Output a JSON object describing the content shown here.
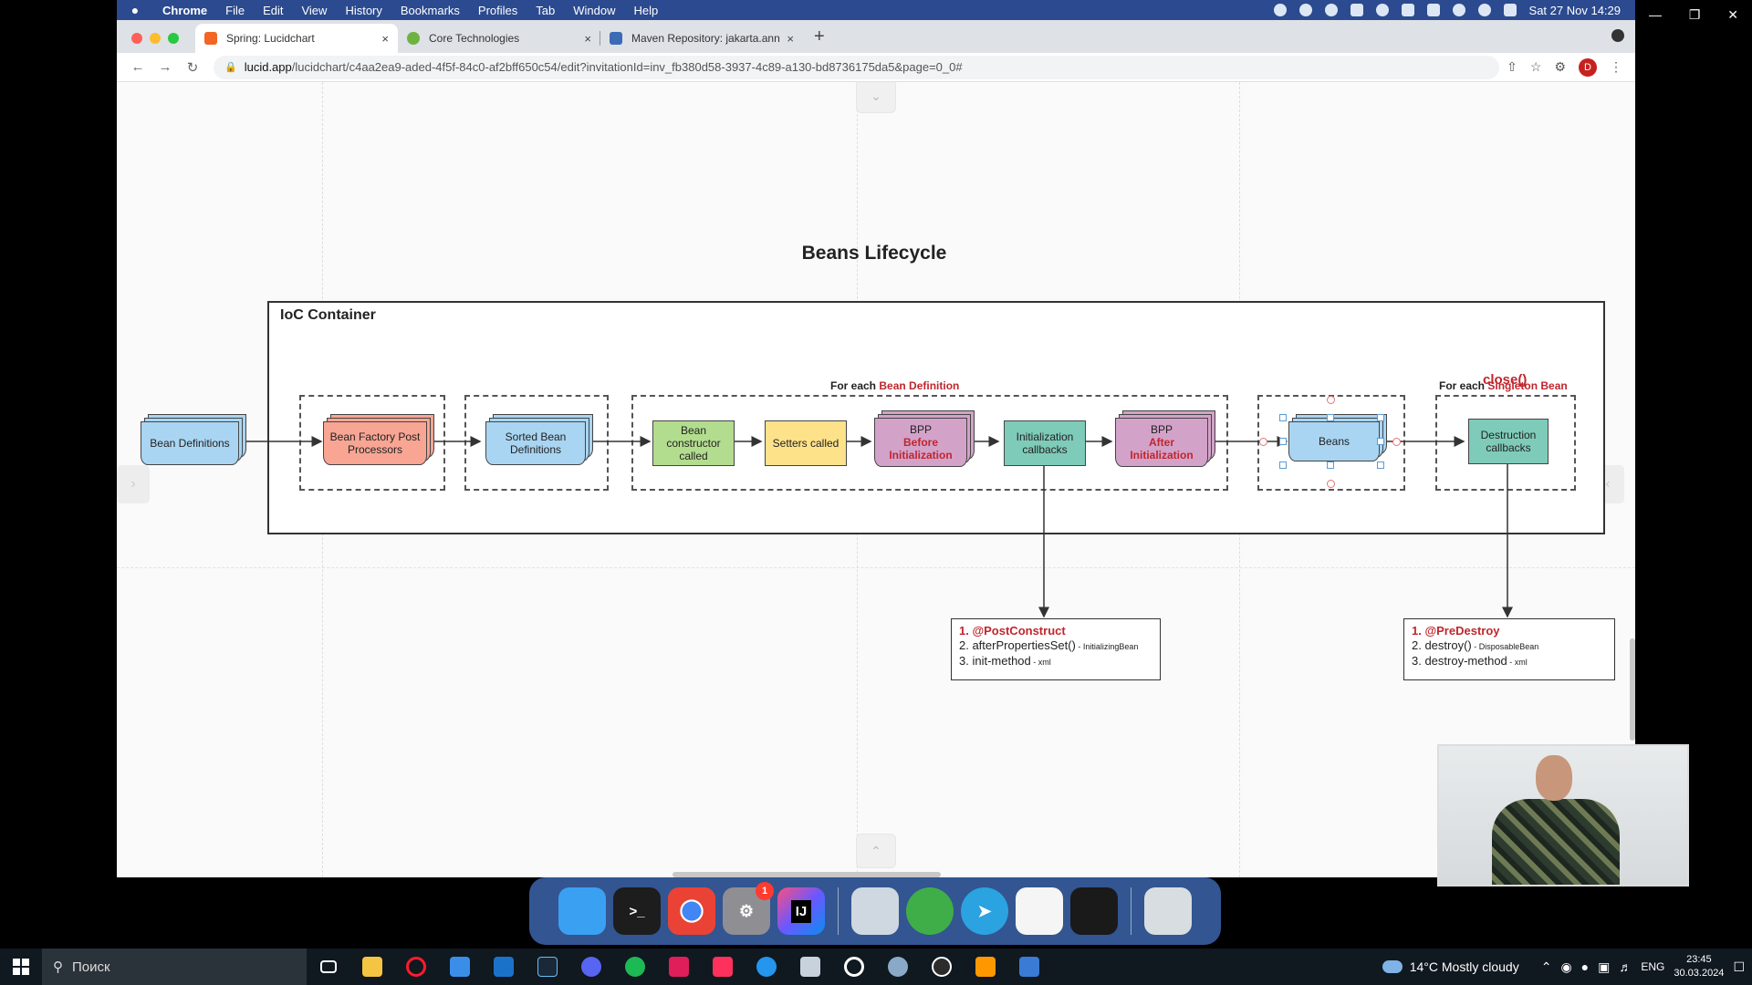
{
  "menubar": {
    "app_name": "Chrome",
    "menus": [
      "File",
      "Edit",
      "View",
      "History",
      "Bookmarks",
      "Profiles",
      "Tab",
      "Window",
      "Help"
    ],
    "datetime": "Sat 27 Nov  14:29"
  },
  "tabs": [
    {
      "title": "Spring: Lucidchart",
      "close": "×",
      "color": "#f26522"
    },
    {
      "title": "Core Technologies",
      "close": "×",
      "color": "#6db33f"
    },
    {
      "title": "Maven Repository: jakarta.ann",
      "close": "×",
      "color": "#3b6bb5"
    }
  ],
  "new_tab": "+",
  "address": {
    "host": "lucid.app",
    "path": "/lucidchart/c4aa2ea9-aded-4f5f-84c0-af2bff650c54/edit?invitationId=inv_fb380d58-3937-4c89-a130-bd8736175da5&page=0_0#"
  },
  "profile_initial": "D",
  "diagram": {
    "title": "Beans Lifecycle",
    "container_label": "IoC Container",
    "caption_each_def": {
      "prefix": "For each ",
      "highlight": "Bean Definition"
    },
    "caption_each_singleton": {
      "prefix": "For each ",
      "highlight": "Singleton Bean"
    },
    "close_label": "close()",
    "nodes": {
      "bean_definitions": "Bean Definitions",
      "bfpp": "Bean Factory Post Processors",
      "sorted_defs": "Sorted Bean Definitions",
      "constructor": "Bean constructor called",
      "setters": "Setters called",
      "bpp_before_top": "BPP",
      "bpp_before_hl": "Before Initialization",
      "init_callbacks": "Initialization callbacks",
      "bpp_after_top": "BPP",
      "bpp_after_hl": "After Initialization",
      "beans": "Beans",
      "destruction": "Destruction callbacks"
    },
    "init_note": {
      "l1": "1. @PostConstruct",
      "l2": "2. afterPropertiesSet()",
      "l2_small": " - InitializingBean",
      "l3": "3. init-method",
      "l3_small": " - xml"
    },
    "destroy_note": {
      "l1": "1. @PreDestroy",
      "l2": "2. destroy()",
      "l2_small": " - DisposableBean",
      "l3": "3. destroy-method",
      "l3_small": " - xml"
    },
    "colors": {
      "blue": "#a9d5f2",
      "salmon": "#f8a594",
      "green": "#b3dd8e",
      "yellow": "#fde28a",
      "purple": "#d3a2c9",
      "teal": "#7ecbb9",
      "accent_red": "#c0262d"
    }
  },
  "dock": {
    "apps": [
      {
        "name": "finder-icon",
        "color": "#3aa0f2",
        "glyph": ""
      },
      {
        "name": "terminal-icon",
        "color": "#1d1d1d",
        "glyph": ">_"
      },
      {
        "name": "chrome-icon",
        "color": "#e6e6e6",
        "glyph": ""
      },
      {
        "name": "system-preferences-icon",
        "color": "#8e8e93",
        "glyph": "⚙",
        "badge": "1"
      },
      {
        "name": "intellij-icon",
        "color": "#000000",
        "glyph": "IJ"
      },
      {
        "name": "preview-icon",
        "color": "#cfd8e0",
        "glyph": ""
      },
      {
        "name": "network-icon",
        "color": "#3fae49",
        "glyph": ""
      },
      {
        "name": "telegram-icon",
        "color": "#2aa3e0",
        "glyph": "➤"
      },
      {
        "name": "textedit-icon",
        "color": "#f5f5f5",
        "glyph": ""
      },
      {
        "name": "audio-app-icon",
        "color": "#1a1a1a",
        "glyph": ""
      },
      {
        "name": "trash-icon",
        "color": "#d8dde2",
        "glyph": ""
      }
    ]
  },
  "taskbar": {
    "search_placeholder": "Поиск",
    "weather": "14°C  Mostly cloudy",
    "lang": "ENG",
    "time": "23:45",
    "date": "30.03.2024"
  }
}
